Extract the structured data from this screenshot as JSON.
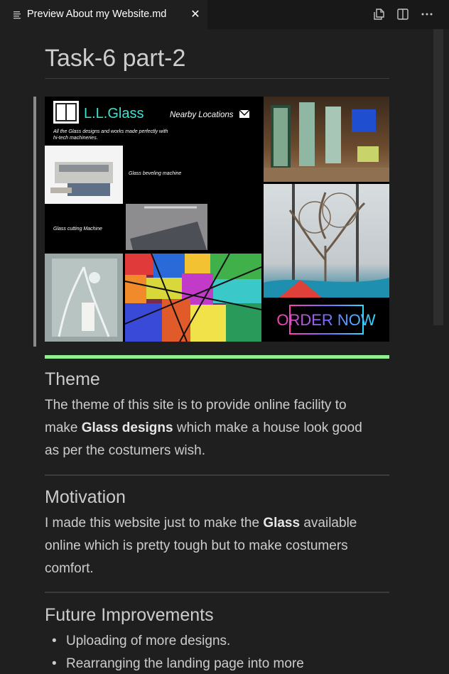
{
  "tab": {
    "title": "Preview About my Website.md",
    "close_glyph": "✕",
    "icon": "preview-lines-icon"
  },
  "toolbar": {
    "open_source_icon": "open-source-icon",
    "split_icon": "split-editor-icon",
    "more_icon": "more-actions-icon"
  },
  "document": {
    "title": "Task-6 part-2",
    "hero": {
      "brand": "L.L.Glass",
      "nav": "Nearby Locations",
      "tagline": [
        "All the Glass designs and works made perfectly with",
        "hi-tech machineries."
      ],
      "beveling": "Glass beveling machine",
      "cutting": "Glass cutting Machine",
      "order": "ORDER NOW"
    },
    "sections": [
      {
        "heading": "Theme",
        "p1": "The theme of this site is to provide online facility to",
        "p2a": "make ",
        "p2b": "Glass designs",
        "p2c": " which make a house look good",
        "p3": "as per the costumers wish."
      },
      {
        "heading": "Motivation",
        "p1a": "I made this website just to make the ",
        "p1b": "Glass",
        "p1c": " available",
        "p2": "online which is pretty tough but to make costumers",
        "p3": "comfort."
      },
      {
        "heading": "Future Improvements",
        "items": [
          "Uploading of more designs.",
          "Rearranging the landing page into more"
        ]
      }
    ]
  },
  "colors": {
    "background": "#1f1f1f",
    "tabbar": "#181818",
    "text": "#cccccc",
    "accent_rule": "#90ee90",
    "brand_teal": "#3fe0d0"
  }
}
